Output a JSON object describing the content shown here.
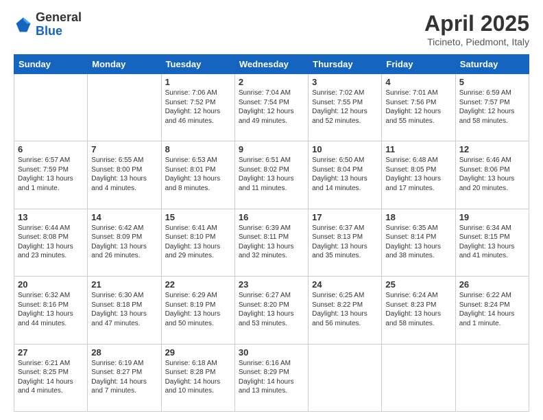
{
  "header": {
    "logo_general": "General",
    "logo_blue": "Blue",
    "month_title": "April 2025",
    "location": "Ticineto, Piedmont, Italy"
  },
  "days_of_week": [
    "Sunday",
    "Monday",
    "Tuesday",
    "Wednesday",
    "Thursday",
    "Friday",
    "Saturday"
  ],
  "weeks": [
    [
      {
        "day": "",
        "text": ""
      },
      {
        "day": "",
        "text": ""
      },
      {
        "day": "1",
        "text": "Sunrise: 7:06 AM\nSunset: 7:52 PM\nDaylight: 12 hours and 46 minutes."
      },
      {
        "day": "2",
        "text": "Sunrise: 7:04 AM\nSunset: 7:54 PM\nDaylight: 12 hours and 49 minutes."
      },
      {
        "day": "3",
        "text": "Sunrise: 7:02 AM\nSunset: 7:55 PM\nDaylight: 12 hours and 52 minutes."
      },
      {
        "day": "4",
        "text": "Sunrise: 7:01 AM\nSunset: 7:56 PM\nDaylight: 12 hours and 55 minutes."
      },
      {
        "day": "5",
        "text": "Sunrise: 6:59 AM\nSunset: 7:57 PM\nDaylight: 12 hours and 58 minutes."
      }
    ],
    [
      {
        "day": "6",
        "text": "Sunrise: 6:57 AM\nSunset: 7:59 PM\nDaylight: 13 hours and 1 minute."
      },
      {
        "day": "7",
        "text": "Sunrise: 6:55 AM\nSunset: 8:00 PM\nDaylight: 13 hours and 4 minutes."
      },
      {
        "day": "8",
        "text": "Sunrise: 6:53 AM\nSunset: 8:01 PM\nDaylight: 13 hours and 8 minutes."
      },
      {
        "day": "9",
        "text": "Sunrise: 6:51 AM\nSunset: 8:02 PM\nDaylight: 13 hours and 11 minutes."
      },
      {
        "day": "10",
        "text": "Sunrise: 6:50 AM\nSunset: 8:04 PM\nDaylight: 13 hours and 14 minutes."
      },
      {
        "day": "11",
        "text": "Sunrise: 6:48 AM\nSunset: 8:05 PM\nDaylight: 13 hours and 17 minutes."
      },
      {
        "day": "12",
        "text": "Sunrise: 6:46 AM\nSunset: 8:06 PM\nDaylight: 13 hours and 20 minutes."
      }
    ],
    [
      {
        "day": "13",
        "text": "Sunrise: 6:44 AM\nSunset: 8:08 PM\nDaylight: 13 hours and 23 minutes."
      },
      {
        "day": "14",
        "text": "Sunrise: 6:42 AM\nSunset: 8:09 PM\nDaylight: 13 hours and 26 minutes."
      },
      {
        "day": "15",
        "text": "Sunrise: 6:41 AM\nSunset: 8:10 PM\nDaylight: 13 hours and 29 minutes."
      },
      {
        "day": "16",
        "text": "Sunrise: 6:39 AM\nSunset: 8:11 PM\nDaylight: 13 hours and 32 minutes."
      },
      {
        "day": "17",
        "text": "Sunrise: 6:37 AM\nSunset: 8:13 PM\nDaylight: 13 hours and 35 minutes."
      },
      {
        "day": "18",
        "text": "Sunrise: 6:35 AM\nSunset: 8:14 PM\nDaylight: 13 hours and 38 minutes."
      },
      {
        "day": "19",
        "text": "Sunrise: 6:34 AM\nSunset: 8:15 PM\nDaylight: 13 hours and 41 minutes."
      }
    ],
    [
      {
        "day": "20",
        "text": "Sunrise: 6:32 AM\nSunset: 8:16 PM\nDaylight: 13 hours and 44 minutes."
      },
      {
        "day": "21",
        "text": "Sunrise: 6:30 AM\nSunset: 8:18 PM\nDaylight: 13 hours and 47 minutes."
      },
      {
        "day": "22",
        "text": "Sunrise: 6:29 AM\nSunset: 8:19 PM\nDaylight: 13 hours and 50 minutes."
      },
      {
        "day": "23",
        "text": "Sunrise: 6:27 AM\nSunset: 8:20 PM\nDaylight: 13 hours and 53 minutes."
      },
      {
        "day": "24",
        "text": "Sunrise: 6:25 AM\nSunset: 8:22 PM\nDaylight: 13 hours and 56 minutes."
      },
      {
        "day": "25",
        "text": "Sunrise: 6:24 AM\nSunset: 8:23 PM\nDaylight: 13 hours and 58 minutes."
      },
      {
        "day": "26",
        "text": "Sunrise: 6:22 AM\nSunset: 8:24 PM\nDaylight: 14 hours and 1 minute."
      }
    ],
    [
      {
        "day": "27",
        "text": "Sunrise: 6:21 AM\nSunset: 8:25 PM\nDaylight: 14 hours and 4 minutes."
      },
      {
        "day": "28",
        "text": "Sunrise: 6:19 AM\nSunset: 8:27 PM\nDaylight: 14 hours and 7 minutes."
      },
      {
        "day": "29",
        "text": "Sunrise: 6:18 AM\nSunset: 8:28 PM\nDaylight: 14 hours and 10 minutes."
      },
      {
        "day": "30",
        "text": "Sunrise: 6:16 AM\nSunset: 8:29 PM\nDaylight: 14 hours and 13 minutes."
      },
      {
        "day": "",
        "text": ""
      },
      {
        "day": "",
        "text": ""
      },
      {
        "day": "",
        "text": ""
      }
    ]
  ]
}
